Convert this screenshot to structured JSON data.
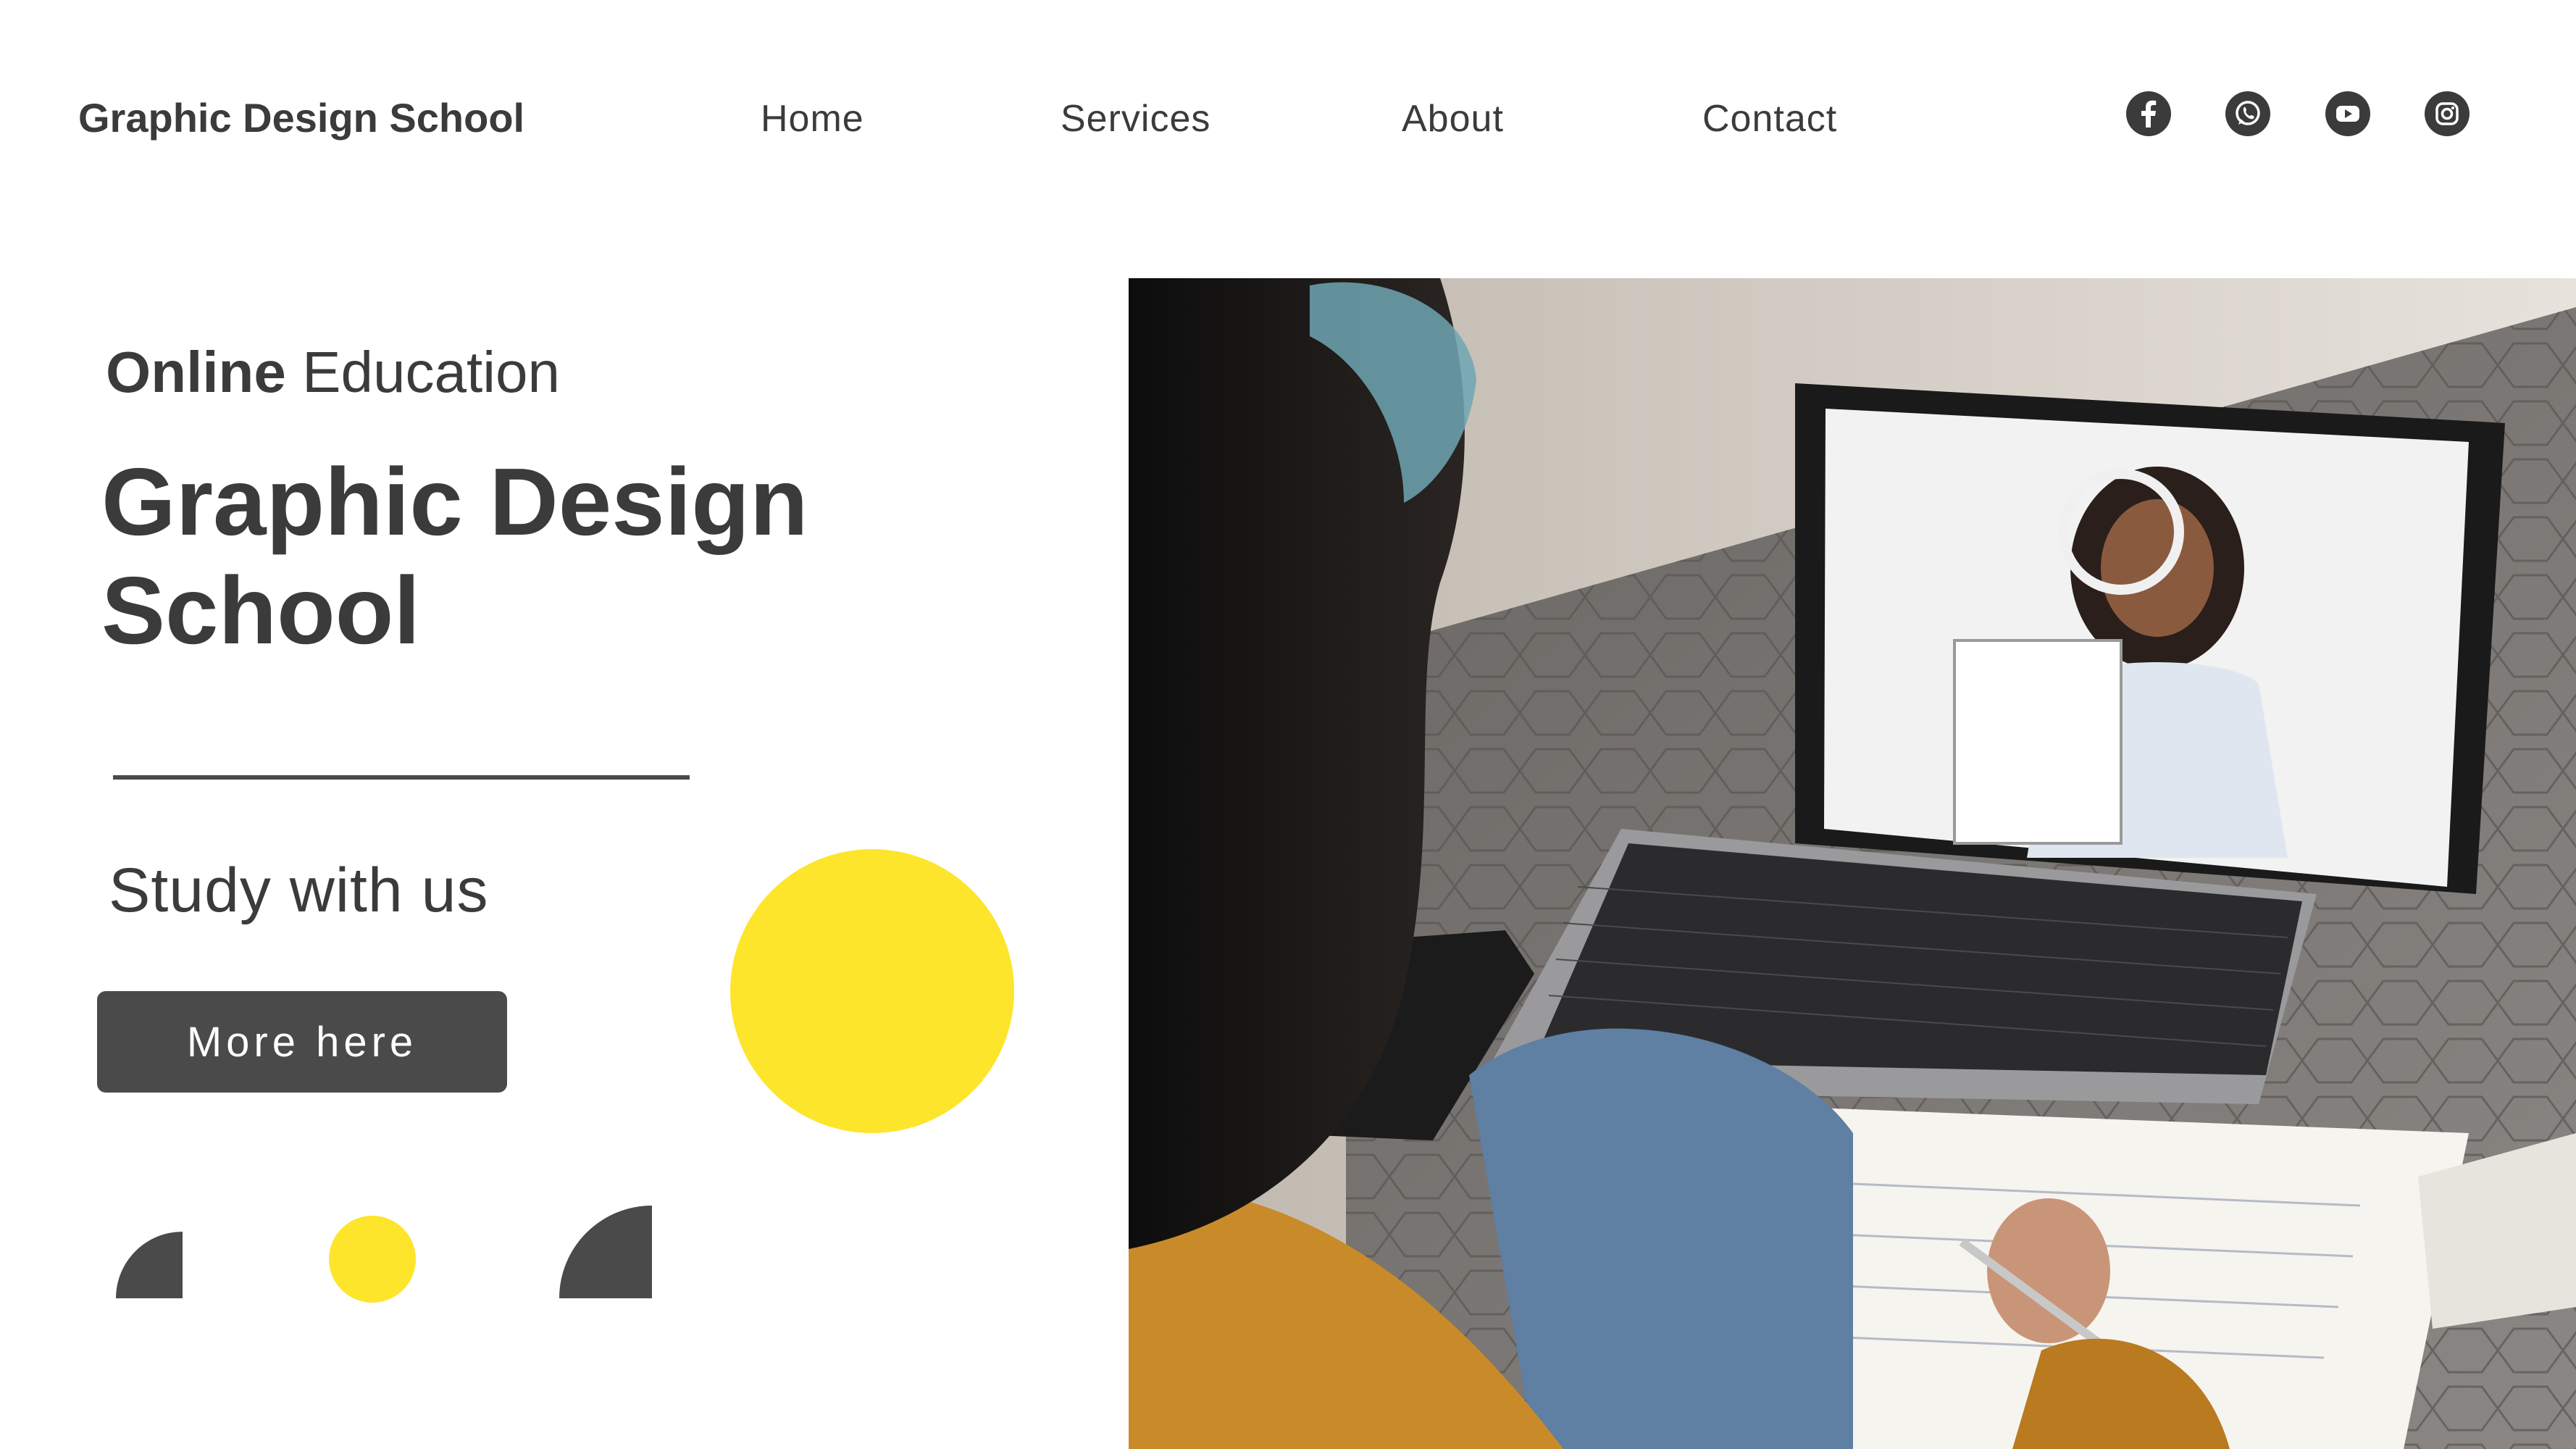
{
  "header": {
    "brand": "Graphic Design School",
    "nav": [
      "Home",
      "Services",
      "About",
      "Contact"
    ],
    "social_icons": [
      "facebook-icon",
      "whatsapp-icon",
      "youtube-icon",
      "instagram-icon"
    ]
  },
  "hero": {
    "kicker_bold": "Online",
    "kicker_rest": "Education",
    "title_line1": "Graphic Design",
    "title_line2": "School",
    "subhead": "Study with us",
    "cta_label": "More here"
  },
  "colors": {
    "text": "#3b3b3b",
    "button": "#4a4a4a",
    "accent_yellow": "#fde52c",
    "background": "#ffffff"
  },
  "photo": {
    "subject": "student-on-video-call-photo"
  }
}
